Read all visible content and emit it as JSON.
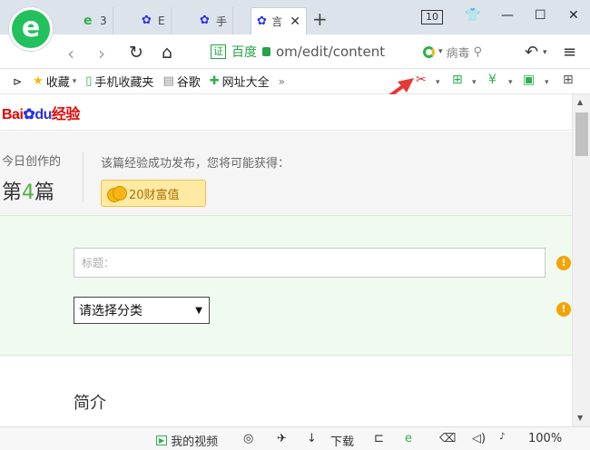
{
  "browser": {
    "tabs": [
      {
        "label": "3",
        "icon": "ie-icon"
      },
      {
        "label": "E",
        "icon": "baidu-paw-icon"
      },
      {
        "label": "手",
        "icon": "baidu-paw-icon"
      },
      {
        "label": "言",
        "icon": "baidu-paw-icon",
        "active": true
      }
    ],
    "tab_count": "10",
    "address": {
      "cert_label": "证",
      "site_name": "百度",
      "url": "om/edit/content"
    },
    "search_hint": "病毒"
  },
  "bookmarks": [
    "收藏",
    "手机收藏夹",
    "谷歌",
    "网址大全"
  ],
  "page": {
    "stats": {
      "today_label": "今日创作的",
      "count_prefix": "第",
      "count_value": "4",
      "count_suffix": "篇",
      "publish_note": "该篇经验成功发布，您将可能获得：",
      "reward": "20财富值"
    },
    "form": {
      "title_placeholder": "标题：",
      "category_default": "请选择分类",
      "warn_symbol": "!"
    },
    "intro_heading": "简介"
  },
  "statusbar": {
    "video": "我的视频",
    "download": "下载",
    "zoom": "100%"
  },
  "colors": {
    "accent_green": "#26a344",
    "baidu_red": "#e10602",
    "baidu_blue": "#2932e1",
    "warning_orange": "#f5a300",
    "arrow_red": "#e53935"
  }
}
